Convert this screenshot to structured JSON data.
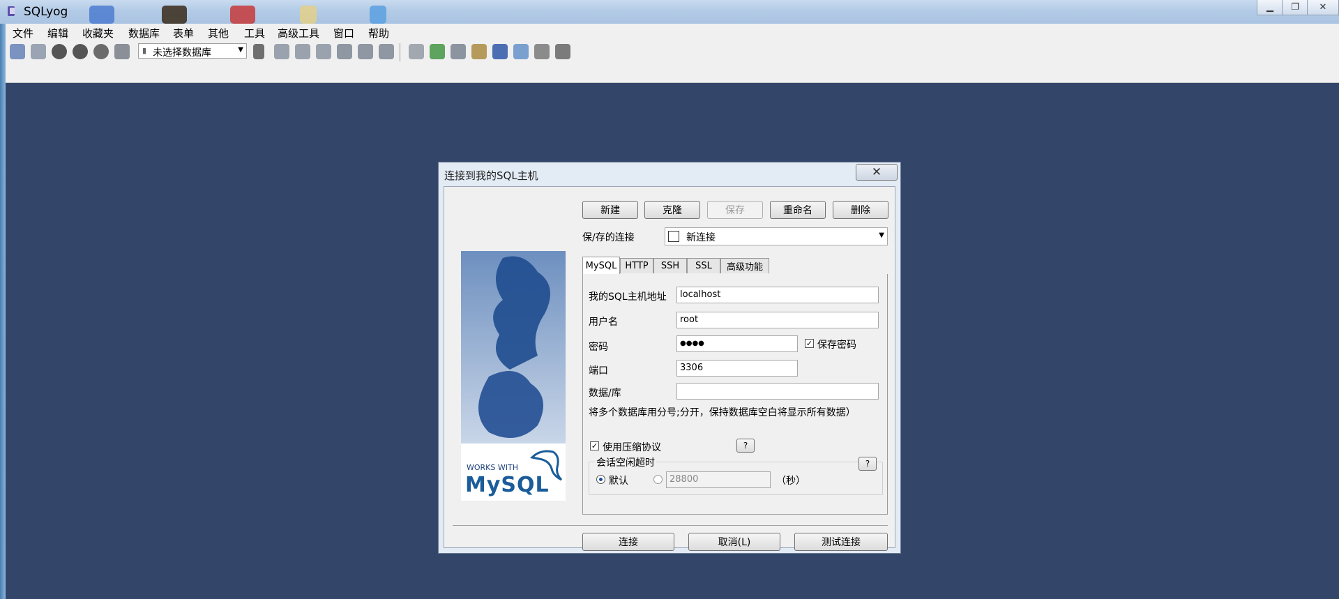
{
  "window": {
    "title": "SQLyog"
  },
  "menu": [
    "文件",
    "编辑",
    "收藏夹",
    "数据库",
    "表单",
    "其他",
    "工具",
    "高级工具",
    "窗口",
    "帮助"
  ],
  "toolbar": {
    "db_select": "未选择数据库"
  },
  "dialog": {
    "title": "连接到我的SQL主机",
    "close": "✕",
    "buttons": {
      "new": "新建",
      "clone": "克隆",
      "save": "保存",
      "rename": "重命名",
      "delete": "删除"
    },
    "saved_connection_label": "保/存的连接",
    "saved_connection_value": "新连接",
    "tabs": [
      "MySQL",
      "HTTP",
      "SSH",
      "SSL",
      "高级功能"
    ],
    "fields": {
      "host_label": "我的SQL主机地址",
      "host_value": "localhost",
      "user_label": "用户名",
      "user_value": "root",
      "password_label": "密码",
      "password_value": "●●●●",
      "save_password_label": "保存密码",
      "port_label": "端口",
      "port_value": "3306",
      "database_label": "数据/库",
      "database_value": "",
      "hint": "将多个数据库用分号;分开，保持数据库空白将显示所有数据）"
    },
    "compression_label": "使用压缩协议",
    "help": "?",
    "session_group_label": "会话空闲超时",
    "default_label": "默认",
    "timeout_value": "28800",
    "seconds_label": "（秒）",
    "footer": {
      "connect": "连接",
      "cancel": "取消(L)",
      "test": "测试连接"
    },
    "logo": {
      "works_with": "WORKS WITH",
      "brand": "MySQL"
    }
  },
  "colors": {
    "desktop": "#33466a",
    "titlebar": "#b3cbe6",
    "dialog_frame": "#e3ebf5",
    "dialog_body": "#f0f0f0"
  }
}
